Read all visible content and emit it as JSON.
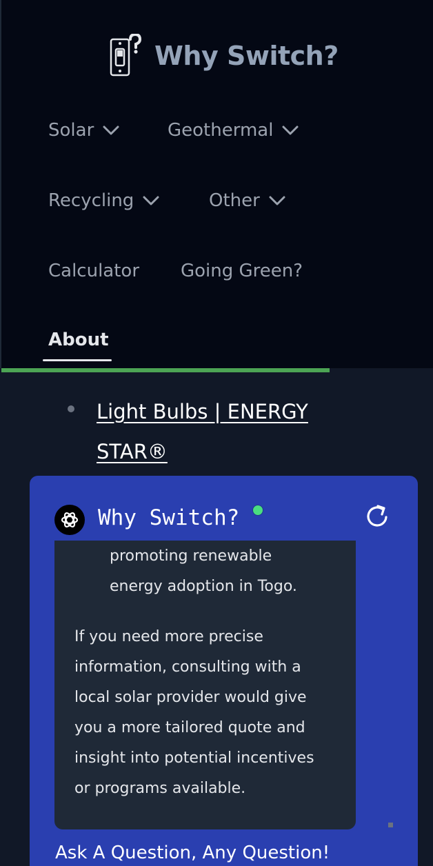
{
  "header": {
    "brand_name": "Why Switch?",
    "logo_icon": "light-switch-question-icon"
  },
  "nav": {
    "items": [
      {
        "label": "Solar",
        "has_dropdown": true
      },
      {
        "label": "Geothermal",
        "has_dropdown": true
      },
      {
        "label": "Recycling",
        "has_dropdown": true
      },
      {
        "label": "Other",
        "has_dropdown": true
      },
      {
        "label": "Calculator",
        "has_dropdown": false
      },
      {
        "label": "Going Green?",
        "has_dropdown": false
      }
    ],
    "active": {
      "label": "About"
    }
  },
  "reading_progress": 0.76,
  "content": {
    "link_text": "Light Bulbs | ENERGY STAR®"
  },
  "chat": {
    "title": "Why Switch?",
    "avatar_icon": "openai-logo-icon",
    "status": "online",
    "refresh_icon": "refresh-icon",
    "messages": {
      "list_item_lines": [
        "promoting renewable",
        "energy adoption in Togo."
      ],
      "paragraph_lines": [
        "If you need more precise",
        "information, consulting with a",
        "local solar provider would give",
        "you a more tailored quote and",
        "insight into potential incentives",
        "or programs available."
      ]
    },
    "prompt_label": "Ask A Question, Any Question!"
  },
  "colors": {
    "header_bg": "#040814",
    "page_bg": "#111827",
    "chat_bg": "#2a3fb0",
    "message_bg": "#1f2937",
    "progress": "#4ca454",
    "status_online": "#4ade80"
  }
}
